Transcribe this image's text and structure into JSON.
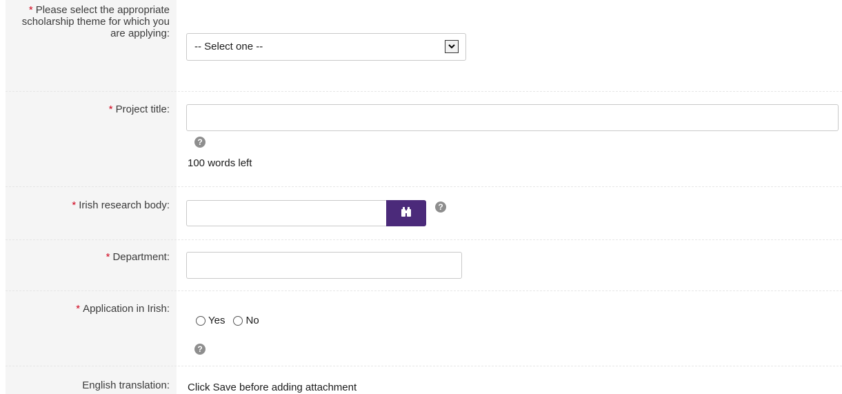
{
  "fields": {
    "theme": {
      "required_mark": "*",
      "label": "Please select the appropriate scholarship theme for which you are applying:",
      "selected_value": "-- Select one --"
    },
    "project_title": {
      "required_mark": "*",
      "label": "Project title:",
      "value": "",
      "words_left": "100 words left"
    },
    "research_body": {
      "required_mark": "*",
      "label": "Irish research body:",
      "value": ""
    },
    "department": {
      "required_mark": "*",
      "label": "Department:",
      "value": ""
    },
    "application_irish": {
      "required_mark": "*",
      "label": "Application in Irish:",
      "options": [
        "Yes",
        "No"
      ]
    },
    "english_translation": {
      "label": "English translation:",
      "message": "Click Save before adding attachment"
    }
  },
  "help_icon_glyph": "?",
  "colors": {
    "required": "#d0021b",
    "lookup_button": "#4b2a7a",
    "label_bg": "#f5f5f5"
  }
}
